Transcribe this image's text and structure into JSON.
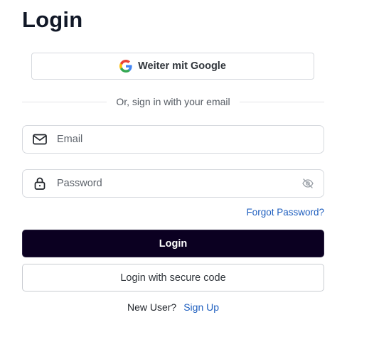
{
  "title": "Login",
  "google_button": {
    "label": "Weiter mit Google",
    "icon": "google-g-icon"
  },
  "divider_text": "Or, sign in with your email",
  "email_field": {
    "placeholder": "Email",
    "value": "",
    "icon": "envelope-icon"
  },
  "password_field": {
    "placeholder": "Password",
    "value": "",
    "icon": "lock-icon",
    "toggle_icon": "eye-off-icon"
  },
  "forgot_password": "Forgot Password?",
  "login_button": "Login",
  "secure_code_button": "Login with secure code",
  "signup": {
    "question": "New User?",
    "link": "Sign Up"
  },
  "colors": {
    "primary_button": "#0b0021",
    "link": "#1f5fbf",
    "border": "#d6d9de"
  }
}
